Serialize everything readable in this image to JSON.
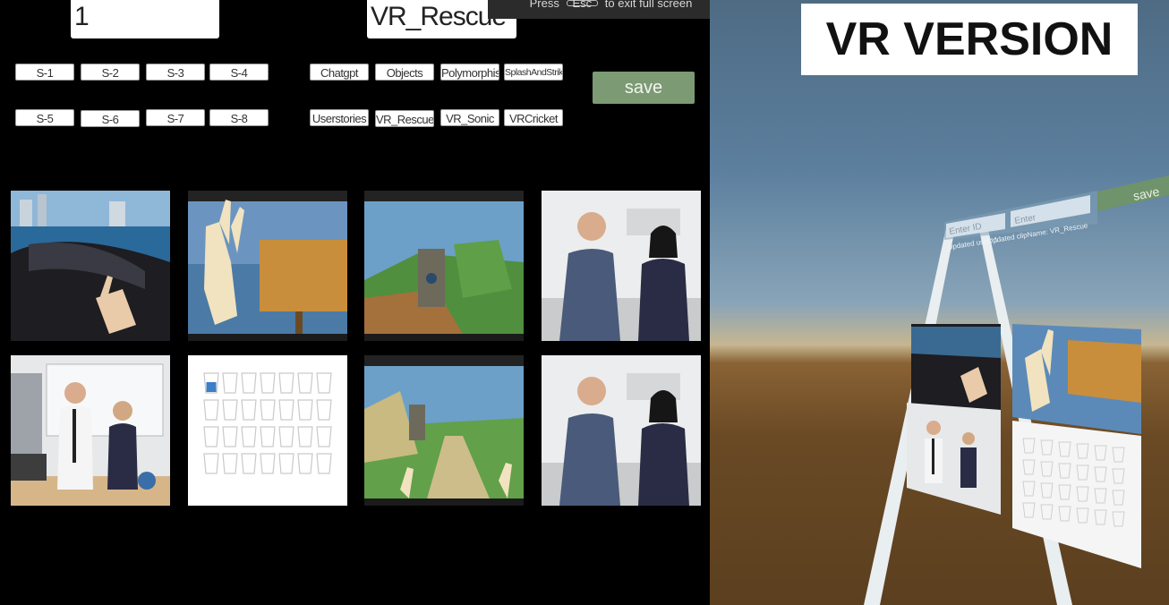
{
  "overlay": {
    "press_label": "Press",
    "key_label": "Esc",
    "exit_label": "to exit full screen"
  },
  "inputs": {
    "user_id": "1",
    "clip_name": "VR_Rescue"
  },
  "user_buttons": [
    "S-1",
    "S-2",
    "S-3",
    "S-4",
    "S-5",
    "S-6",
    "S-7",
    "S-8"
  ],
  "clip_buttons": [
    "Chatgpt",
    "Objects",
    "Polymorphism",
    "SplashAndStrike",
    "Userstories",
    "VR_Rescue",
    "VR_Sonic",
    "VRCricket"
  ],
  "save_label": "save",
  "thumbnails": [
    {
      "scene": "vr-car-hand"
    },
    {
      "scene": "vr-hand-sign"
    },
    {
      "scene": "vr-game-world"
    },
    {
      "scene": "kitchen-presenters"
    },
    {
      "scene": "lab-presenters"
    },
    {
      "scene": "cups-grid"
    },
    {
      "scene": "vr-green-path"
    },
    {
      "scene": "kitchen-presenters"
    }
  ],
  "vr": {
    "title": "VR VERSION",
    "enter_id_placeholder": "Enter ID",
    "enter_placeholder": "Enter",
    "save_label": "save",
    "status_user": "Updated user: 1",
    "status_clip": "Updated clipName: VR_Rescue"
  },
  "colors": {
    "save_green": "#7c9a73",
    "background": "#000000"
  }
}
